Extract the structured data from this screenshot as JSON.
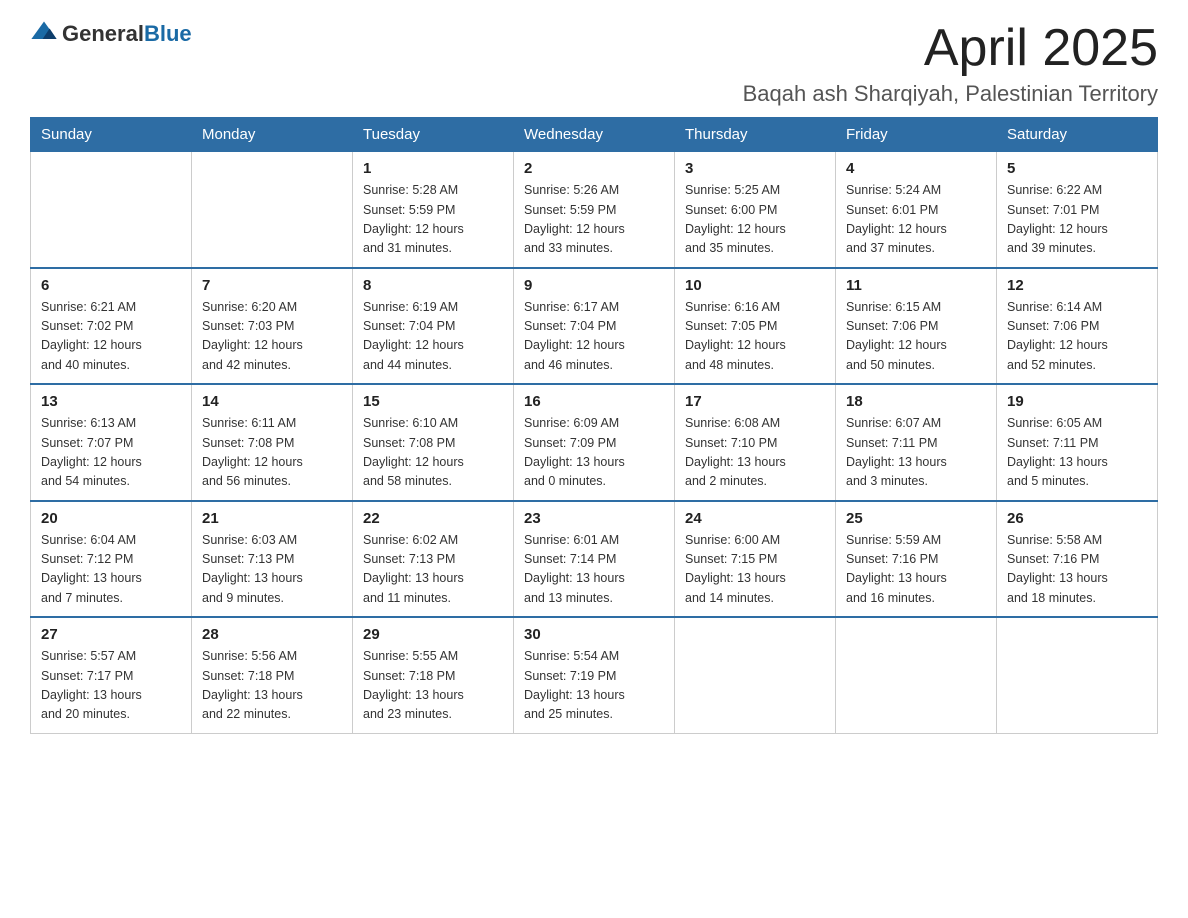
{
  "logo": {
    "text_general": "General",
    "text_blue": "Blue"
  },
  "title": "April 2025",
  "location": "Baqah ash Sharqiyah, Palestinian Territory",
  "weekdays": [
    "Sunday",
    "Monday",
    "Tuesday",
    "Wednesday",
    "Thursday",
    "Friday",
    "Saturday"
  ],
  "weeks": [
    [
      {
        "day": "",
        "info": ""
      },
      {
        "day": "",
        "info": ""
      },
      {
        "day": "1",
        "info": "Sunrise: 5:28 AM\nSunset: 5:59 PM\nDaylight: 12 hours\nand 31 minutes."
      },
      {
        "day": "2",
        "info": "Sunrise: 5:26 AM\nSunset: 5:59 PM\nDaylight: 12 hours\nand 33 minutes."
      },
      {
        "day": "3",
        "info": "Sunrise: 5:25 AM\nSunset: 6:00 PM\nDaylight: 12 hours\nand 35 minutes."
      },
      {
        "day": "4",
        "info": "Sunrise: 5:24 AM\nSunset: 6:01 PM\nDaylight: 12 hours\nand 37 minutes."
      },
      {
        "day": "5",
        "info": "Sunrise: 6:22 AM\nSunset: 7:01 PM\nDaylight: 12 hours\nand 39 minutes."
      }
    ],
    [
      {
        "day": "6",
        "info": "Sunrise: 6:21 AM\nSunset: 7:02 PM\nDaylight: 12 hours\nand 40 minutes."
      },
      {
        "day": "7",
        "info": "Sunrise: 6:20 AM\nSunset: 7:03 PM\nDaylight: 12 hours\nand 42 minutes."
      },
      {
        "day": "8",
        "info": "Sunrise: 6:19 AM\nSunset: 7:04 PM\nDaylight: 12 hours\nand 44 minutes."
      },
      {
        "day": "9",
        "info": "Sunrise: 6:17 AM\nSunset: 7:04 PM\nDaylight: 12 hours\nand 46 minutes."
      },
      {
        "day": "10",
        "info": "Sunrise: 6:16 AM\nSunset: 7:05 PM\nDaylight: 12 hours\nand 48 minutes."
      },
      {
        "day": "11",
        "info": "Sunrise: 6:15 AM\nSunset: 7:06 PM\nDaylight: 12 hours\nand 50 minutes."
      },
      {
        "day": "12",
        "info": "Sunrise: 6:14 AM\nSunset: 7:06 PM\nDaylight: 12 hours\nand 52 minutes."
      }
    ],
    [
      {
        "day": "13",
        "info": "Sunrise: 6:13 AM\nSunset: 7:07 PM\nDaylight: 12 hours\nand 54 minutes."
      },
      {
        "day": "14",
        "info": "Sunrise: 6:11 AM\nSunset: 7:08 PM\nDaylight: 12 hours\nand 56 minutes."
      },
      {
        "day": "15",
        "info": "Sunrise: 6:10 AM\nSunset: 7:08 PM\nDaylight: 12 hours\nand 58 minutes."
      },
      {
        "day": "16",
        "info": "Sunrise: 6:09 AM\nSunset: 7:09 PM\nDaylight: 13 hours\nand 0 minutes."
      },
      {
        "day": "17",
        "info": "Sunrise: 6:08 AM\nSunset: 7:10 PM\nDaylight: 13 hours\nand 2 minutes."
      },
      {
        "day": "18",
        "info": "Sunrise: 6:07 AM\nSunset: 7:11 PM\nDaylight: 13 hours\nand 3 minutes."
      },
      {
        "day": "19",
        "info": "Sunrise: 6:05 AM\nSunset: 7:11 PM\nDaylight: 13 hours\nand 5 minutes."
      }
    ],
    [
      {
        "day": "20",
        "info": "Sunrise: 6:04 AM\nSunset: 7:12 PM\nDaylight: 13 hours\nand 7 minutes."
      },
      {
        "day": "21",
        "info": "Sunrise: 6:03 AM\nSunset: 7:13 PM\nDaylight: 13 hours\nand 9 minutes."
      },
      {
        "day": "22",
        "info": "Sunrise: 6:02 AM\nSunset: 7:13 PM\nDaylight: 13 hours\nand 11 minutes."
      },
      {
        "day": "23",
        "info": "Sunrise: 6:01 AM\nSunset: 7:14 PM\nDaylight: 13 hours\nand 13 minutes."
      },
      {
        "day": "24",
        "info": "Sunrise: 6:00 AM\nSunset: 7:15 PM\nDaylight: 13 hours\nand 14 minutes."
      },
      {
        "day": "25",
        "info": "Sunrise: 5:59 AM\nSunset: 7:16 PM\nDaylight: 13 hours\nand 16 minutes."
      },
      {
        "day": "26",
        "info": "Sunrise: 5:58 AM\nSunset: 7:16 PM\nDaylight: 13 hours\nand 18 minutes."
      }
    ],
    [
      {
        "day": "27",
        "info": "Sunrise: 5:57 AM\nSunset: 7:17 PM\nDaylight: 13 hours\nand 20 minutes."
      },
      {
        "day": "28",
        "info": "Sunrise: 5:56 AM\nSunset: 7:18 PM\nDaylight: 13 hours\nand 22 minutes."
      },
      {
        "day": "29",
        "info": "Sunrise: 5:55 AM\nSunset: 7:18 PM\nDaylight: 13 hours\nand 23 minutes."
      },
      {
        "day": "30",
        "info": "Sunrise: 5:54 AM\nSunset: 7:19 PM\nDaylight: 13 hours\nand 25 minutes."
      },
      {
        "day": "",
        "info": ""
      },
      {
        "day": "",
        "info": ""
      },
      {
        "day": "",
        "info": ""
      }
    ]
  ]
}
